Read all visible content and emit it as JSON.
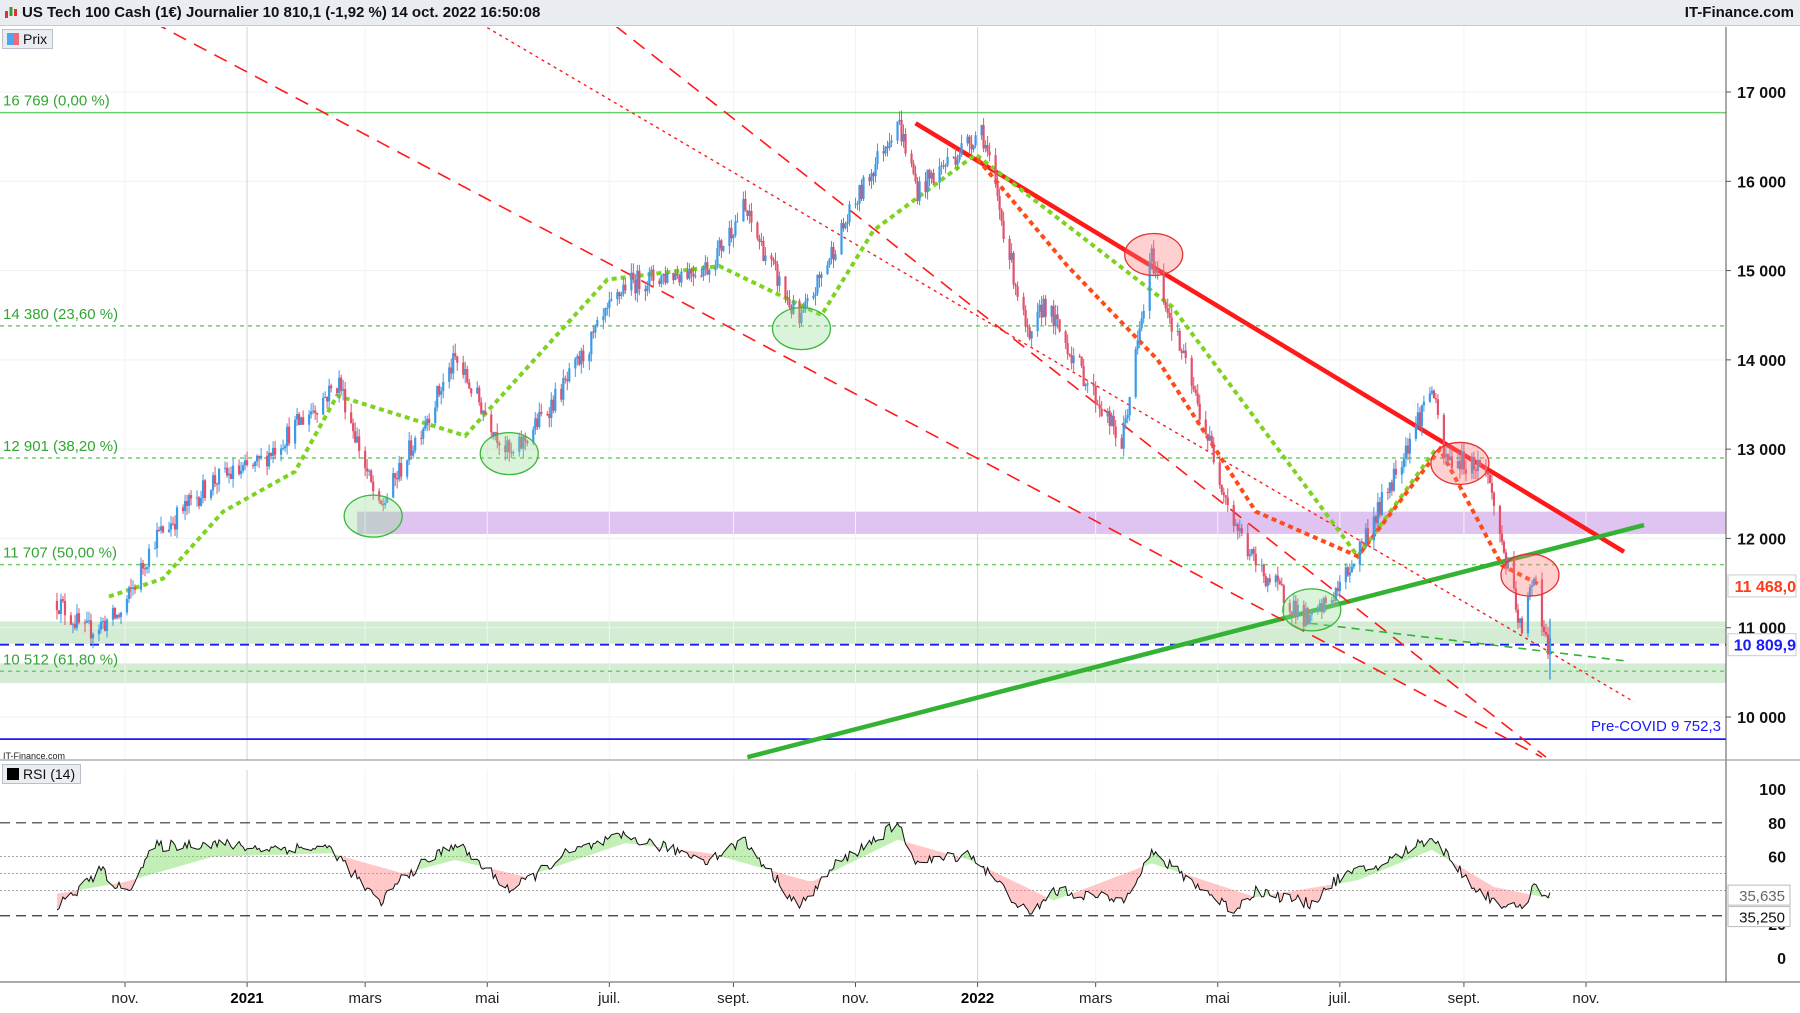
{
  "header": {
    "title": "US Tech 100 Cash (1€) Journalier 10 810,1 (-1,92 %) 14 oct. 2022 16:50:08",
    "brand": "IT-Finance.com",
    "source_small": "IT-Finance.com"
  },
  "legend": {
    "price_label": "Prix",
    "rsi_label": "RSI (14)"
  },
  "chart_data": [
    {
      "type": "line",
      "title": "US Tech 100 Cash (1€) Journalier",
      "last_price": "10 810,1",
      "change": "-1,92 %",
      "timestamp": "14 oct. 2022 16:50:08",
      "x_tick_labels": [
        "nov.",
        "2021",
        "mars",
        "mai",
        "juil.",
        "sept.",
        "nov.",
        "2022",
        "mars",
        "mai",
        "juil.",
        "sept.",
        "nov."
      ],
      "y_tick_labels": [
        "17 000",
        "16 000",
        "15 000",
        "14 000",
        "13 000",
        "12 000",
        "11 000",
        "10 000"
      ],
      "ylim": [
        9550,
        17800
      ],
      "grid": true,
      "price_path": {
        "dates": [
          "2020-09-28",
          "2020-10-12",
          "2020-10-30",
          "2020-11-16",
          "2020-12-15",
          "2021-01-05",
          "2021-02-16",
          "2021-03-08",
          "2021-04-15",
          "2021-05-13",
          "2021-06-10",
          "2021-07-09",
          "2021-08-20",
          "2021-09-06",
          "2021-10-04",
          "2021-10-22",
          "2021-11-22",
          "2021-12-02",
          "2021-12-28",
          "2022-01-03",
          "2022-01-27",
          "2022-02-03",
          "2022-03-14",
          "2022-03-29",
          "2022-05-09",
          "2022-05-20",
          "2022-06-16",
          "2022-07-01",
          "2022-07-22",
          "2022-08-16",
          "2022-08-22",
          "2022-09-12",
          "2022-09-30",
          "2022-10-06",
          "2022-10-13",
          "2022-10-14"
        ],
        "close": [
          11300,
          10950,
          11150,
          12000,
          12650,
          12800,
          13750,
          12300,
          14000,
          12900,
          13750,
          14850,
          15050,
          15700,
          14400,
          15300,
          16700,
          15900,
          16450,
          16600,
          14150,
          14650,
          13050,
          15150,
          12200,
          11700,
          11050,
          11450,
          12400,
          13700,
          12900,
          12800,
          10900,
          11650,
          10700,
          10810
        ]
      },
      "moving_average_rising": {
        "dates": [
          "2020-10-24",
          "2020-11-20",
          "2020-12-20",
          "2021-01-25",
          "2021-02-15",
          "2021-04-20",
          "2021-06-30",
          "2021-08-25",
          "2021-10-15",
          "2021-11-10",
          "2021-12-31",
          "2022-04-08",
          "2022-07-10",
          "2022-08-18"
        ],
        "values": [
          11350,
          11550,
          12300,
          12750,
          13600,
          13150,
          14900,
          15050,
          14500,
          15450,
          16300,
          14600,
          11800,
          13000
        ]
      },
      "moving_average_falling": {
        "dates": [
          "2022-01-01",
          "2022-02-15",
          "2022-04-01",
          "2022-05-20",
          "2022-07-10",
          "2022-08-20",
          "2022-09-20",
          "2022-10-10"
        ],
        "values": [
          16250,
          15050,
          14000,
          12300,
          11800,
          13000,
          11700,
          11468
        ]
      },
      "fibonacci_levels": [
        {
          "label": "16 769 (0,00 %)",
          "value": 16769
        },
        {
          "label": "14 380 (23,60 %)",
          "value": 14380
        },
        {
          "label": "12 901 (38,20 %)",
          "value": 12901
        },
        {
          "label": "11 707 (50,00 %)",
          "value": 11707
        },
        {
          "label": "10 512 (61,80 %)",
          "value": 10512
        }
      ],
      "horizontal_lines": [
        {
          "label": "10 809,9",
          "value": 10810,
          "color": "#1a1aff",
          "style": "dashed"
        },
        {
          "label": "Pre-COVID 9 752,3",
          "value": 9752.3,
          "color": "#1a1aff",
          "style": "solid"
        }
      ],
      "price_tags": [
        {
          "label": "11 468,0",
          "value": 11468,
          "color": "#ff3a1a"
        },
        {
          "label": "10 809,9",
          "value": 10810,
          "color": "#1a1aff"
        }
      ],
      "zones": [
        {
          "from": 12050,
          "to": 12300,
          "start": "2021-02-25",
          "color": "#d9b8ee"
        },
        {
          "from": 10820,
          "to": 11070,
          "color": "#cbe9cb"
        },
        {
          "from": 10380,
          "to": 10600,
          "color": "#cbe9cb"
        }
      ],
      "trendlines": [
        {
          "name": "resistance",
          "color": "#ff1a1a",
          "style": "solid",
          "points": [
            [
              "2021-12-01",
              16650
            ],
            [
              "2022-11-20",
              11850
            ]
          ]
        },
        {
          "name": "support",
          "color": "#33b233",
          "style": "solid",
          "points": [
            [
              "2021-09-08",
              9550
            ],
            [
              "2022-11-30",
              12150
            ]
          ]
        },
        {
          "name": "channel-upper",
          "color": "#ff1a1a",
          "style": "dashed",
          "points": [
            [
              "2021-06-25",
              17900
            ],
            [
              "2022-10-12",
              9550
            ]
          ]
        },
        {
          "name": "channel-lower",
          "color": "#ff1a1a",
          "style": "dashed",
          "points": [
            [
              "2020-11-05",
              17900
            ],
            [
              "2022-10-10",
              9550
            ]
          ]
        },
        {
          "name": "channel-middle",
          "color": "#ff1a1a",
          "style": "dotted",
          "points": [
            [
              "2021-04-25",
              17800
            ],
            [
              "2022-11-25",
              10170
            ]
          ]
        },
        {
          "name": "neckline",
          "color": "#33b233",
          "style": "dashed",
          "points": [
            [
              "2022-06-16",
              11050
            ],
            [
              "2022-11-20",
              10630
            ]
          ]
        }
      ],
      "highlight_circles": [
        {
          "date": "2021-03-05",
          "value": 12250,
          "color": "green"
        },
        {
          "date": "2021-05-12",
          "value": 12950,
          "color": "green"
        },
        {
          "date": "2021-10-05",
          "value": 14350,
          "color": "green"
        },
        {
          "date": "2022-06-17",
          "value": 11200,
          "color": "green"
        },
        {
          "date": "2022-03-30",
          "value": 15180,
          "color": "red"
        },
        {
          "date": "2022-08-30",
          "value": 12840,
          "color": "red"
        },
        {
          "date": "2022-10-04",
          "value": 11590,
          "color": "red"
        }
      ]
    },
    {
      "type": "line",
      "title": "RSI (14)",
      "y_tick_labels": [
        "100",
        "80",
        "60",
        "20",
        "0"
      ],
      "ylim": [
        0,
        100
      ],
      "levels": [
        80,
        60,
        50,
        40,
        25
      ],
      "last_values": [
        "35,635",
        "35,250"
      ],
      "rsi": {
        "dates": [
          "2020-09-28",
          "2020-10-20",
          "2020-11-01",
          "2020-11-16",
          "2020-12-15",
          "2021-01-05",
          "2021-02-12",
          "2021-03-08",
          "2021-03-20",
          "2021-04-15",
          "2021-05-13",
          "2021-06-10",
          "2021-07-09",
          "2021-08-20",
          "2021-09-06",
          "2021-10-04",
          "2021-10-22",
          "2021-11-22",
          "2021-12-02",
          "2021-12-28",
          "2022-01-27",
          "2022-02-08",
          "2022-03-14",
          "2022-03-29",
          "2022-05-09",
          "2022-05-20",
          "2022-06-16",
          "2022-07-01",
          "2022-07-22",
          "2022-08-16",
          "2022-09-06",
          "2022-09-16",
          "2022-09-30",
          "2022-10-06",
          "2022-10-14"
        ],
        "values": [
          30,
          52,
          38,
          66,
          68,
          65,
          65,
          32,
          48,
          68,
          40,
          62,
          72,
          58,
          70,
          30,
          55,
          79,
          56,
          62,
          25,
          40,
          34,
          62,
          28,
          40,
          32,
          48,
          55,
          72,
          42,
          34,
          28,
          44,
          35.6
        ]
      },
      "rsi_signal": {
        "dates": [
          "2020-09-28",
          "2020-11-01",
          "2020-12-15",
          "2021-02-12",
          "2021-03-20",
          "2021-04-15",
          "2021-05-20",
          "2021-07-09",
          "2021-08-20",
          "2021-10-10",
          "2021-11-22",
          "2021-12-28",
          "2022-02-08",
          "2022-03-29",
          "2022-05-20",
          "2022-07-10",
          "2022-08-16",
          "2022-09-16",
          "2022-10-14"
        ],
        "values": [
          38,
          45,
          60,
          62,
          50,
          58,
          48,
          68,
          62,
          45,
          70,
          58,
          34,
          56,
          36,
          46,
          64,
          42,
          35.3
        ]
      }
    }
  ]
}
